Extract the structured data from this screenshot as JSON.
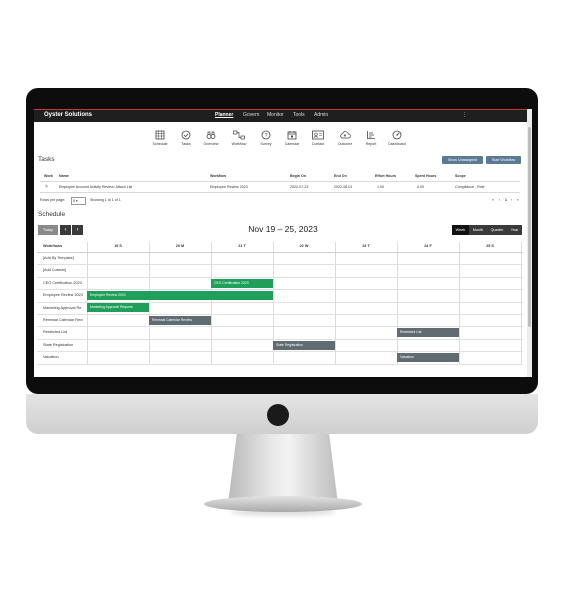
{
  "app": {
    "brand": "Oyster Solutions",
    "nav": [
      "Planner",
      "Govern",
      "Monitor",
      "Tools",
      "Admin"
    ],
    "active_nav": "Planner",
    "menu_dots": "⋮"
  },
  "toolbar": [
    {
      "label": "Schedule",
      "icon": "calendar-grid-icon"
    },
    {
      "label": "Tasks",
      "icon": "check-circle-icon"
    },
    {
      "label": "Overview",
      "icon": "binoculars-icon"
    },
    {
      "label": "Workflow",
      "icon": "workflow-icon"
    },
    {
      "label": "Survey",
      "icon": "question-circle-icon"
    },
    {
      "label": "Calendar",
      "icon": "calendar-icon"
    },
    {
      "label": "Contact",
      "icon": "contact-card-icon"
    },
    {
      "label": "Outcome",
      "icon": "cloud-upload-icon"
    },
    {
      "label": "Report",
      "icon": "report-bars-icon"
    },
    {
      "label": "Dashboard",
      "icon": "gauge-icon"
    }
  ],
  "tasks": {
    "title": "Tasks",
    "show_unassigned": "Show Unassigned",
    "start_workflow": "Start Workflow",
    "columns": [
      "Work",
      "Name",
      "Workflow",
      "Begin On",
      "End On",
      "Effort Hours",
      "Spent Hours",
      "Scope"
    ],
    "rows": [
      {
        "work": "◎",
        "name": "Employee Account Activity Review: Attach List",
        "workflow": "Employee Review 2023",
        "begin": "2022-07-23",
        "end": "2022-08-01",
        "effort": "1.00",
        "spent": "0.00",
        "scope": "Compliance - Role"
      }
    ],
    "rows_per_page_label": "Rows per page:",
    "rows_per_page": "5",
    "showing": "Showing 1 to 1 of 1",
    "pager": [
      "«",
      "‹",
      "1",
      "›",
      "»"
    ]
  },
  "schedule": {
    "title": "Schedule",
    "today": "Today",
    "prev": "‹",
    "next": "›",
    "range": "Nov 19 – 25, 2023",
    "views": [
      "Week",
      "Month",
      "Quarter",
      "Year"
    ],
    "active_view": "Week",
    "first_col": "Workflows",
    "days": [
      "19 S",
      "20 M",
      "21 T",
      "22 W",
      "23 T",
      "24 F",
      "25 S"
    ],
    "rows": [
      "[Add By Template]",
      "[Add Custom]",
      "CEO Certification 2023",
      "Employee Review 2023",
      "Marketing Approval Re",
      "Renewal Calendar Revi",
      "Restricted List",
      "State Registration",
      "Valuation"
    ],
    "events": [
      {
        "label": "CEO Certification 2023",
        "row": 2,
        "start": 2,
        "span": 1,
        "color": "green"
      },
      {
        "label": "Employee Review 2023",
        "row": 3,
        "start": 0,
        "span": 3,
        "color": "green"
      },
      {
        "label": "Marketing Approval Request",
        "row": 4,
        "start": 0,
        "span": 1,
        "color": "green"
      },
      {
        "label": "Renewal Calendar Review",
        "row": 5,
        "start": 1,
        "span": 1,
        "color": "gray"
      },
      {
        "label": "Restricted List",
        "row": 6,
        "start": 5,
        "span": 1,
        "color": "gray"
      },
      {
        "label": "State Registration",
        "row": 7,
        "start": 3,
        "span": 1,
        "color": "gray"
      },
      {
        "label": "Valuation",
        "row": 8,
        "start": 5,
        "span": 1,
        "color": "gray"
      }
    ]
  },
  "colors": {
    "accent_blue": "#5b7a97",
    "event_green": "#1fa05a",
    "event_gray": "#606b72",
    "topbar": "#1f1f1f"
  }
}
